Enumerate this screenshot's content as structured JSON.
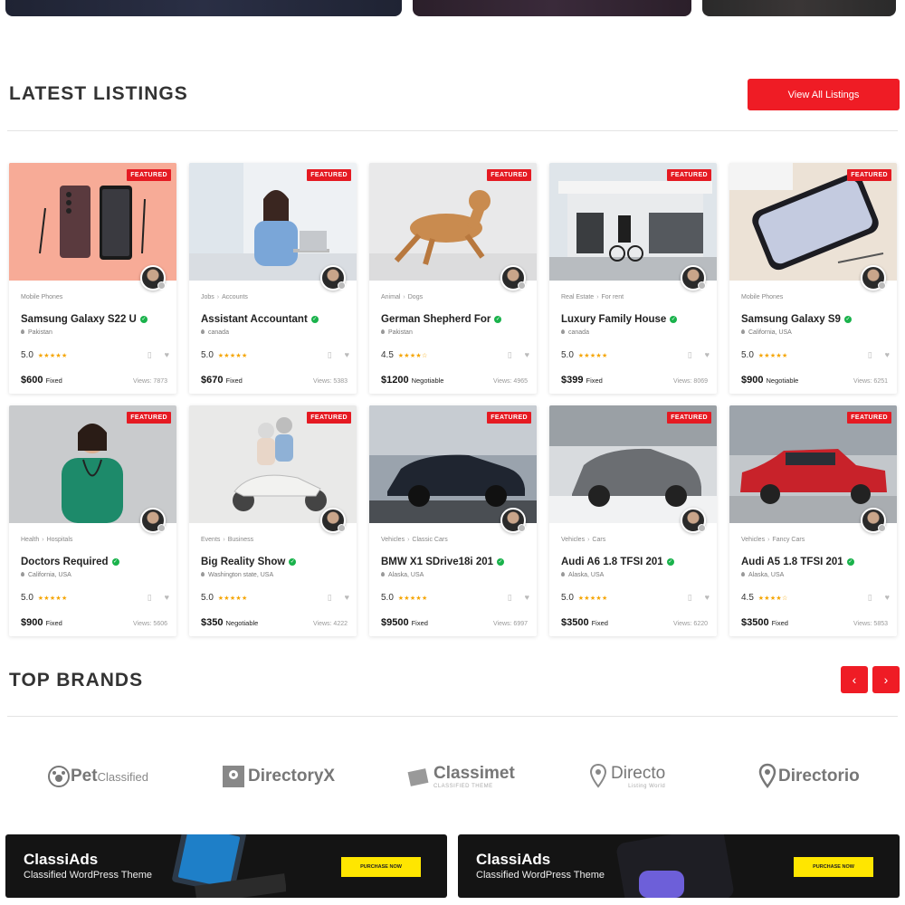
{
  "latest": {
    "title": "LATEST LISTINGS",
    "view_all_label": "View All Listings",
    "featured_label": "FEATURED",
    "listings": [
      {
        "crumb1": "Mobile Phones",
        "crumb2": "",
        "title": "Samsung Galaxy S22 U",
        "location": "Pakistan",
        "rating": "5.0",
        "stars": "★★★★★",
        "price": "$600",
        "price_type": "Fixed",
        "views": "Views: 7873"
      },
      {
        "crumb1": "Jobs",
        "crumb2": "Accounts",
        "title": "Assistant Accountant",
        "location": "canada",
        "rating": "5.0",
        "stars": "★★★★★",
        "price": "$670",
        "price_type": "Fixed",
        "views": "Views: 5383"
      },
      {
        "crumb1": "Animal",
        "crumb2": "Dogs",
        "title": "German Shepherd For",
        "location": "Pakistan",
        "rating": "4.5",
        "stars": "★★★★☆",
        "price": "$1200",
        "price_type": "Negotiable",
        "views": "Views: 4965"
      },
      {
        "crumb1": "Real Estate",
        "crumb2": "For rent",
        "title": "Luxury Family House",
        "location": "canada",
        "rating": "5.0",
        "stars": "★★★★★",
        "price": "$399",
        "price_type": "Fixed",
        "views": "Views: 8069"
      },
      {
        "crumb1": "Mobile Phones",
        "crumb2": "",
        "title": "Samsung Galaxy S9",
        "location": "California, USA",
        "rating": "5.0",
        "stars": "★★★★★",
        "price": "$900",
        "price_type": "Negotiable",
        "views": "Views: 6251"
      },
      {
        "crumb1": "Health",
        "crumb2": "Hospitals",
        "title": "Doctors Required",
        "location": "California, USA",
        "rating": "5.0",
        "stars": "★★★★★",
        "price": "$900",
        "price_type": "Fixed",
        "views": "Views: 5606"
      },
      {
        "crumb1": "Events",
        "crumb2": "Business",
        "title": "Big Reality Show",
        "location": "Washington state, USA",
        "rating": "5.0",
        "stars": "★★★★★",
        "price": "$350",
        "price_type": "Negotiable",
        "views": "Views: 4222"
      },
      {
        "crumb1": "Vehicles",
        "crumb2": "Classic Cars",
        "title": "BMW X1 SDrive18i 201",
        "location": "Alaska, USA",
        "rating": "5.0",
        "stars": "★★★★★",
        "price": "$9500",
        "price_type": "Fixed",
        "views": "Views: 6997"
      },
      {
        "crumb1": "Vehicles",
        "crumb2": "Cars",
        "title": "Audi A6 1.8 TFSI 201",
        "location": "Alaska, USA",
        "rating": "5.0",
        "stars": "★★★★★",
        "price": "$3500",
        "price_type": "Fixed",
        "views": "Views: 6220"
      },
      {
        "crumb1": "Vehicles",
        "crumb2": "Fancy Cars",
        "title": "Audi A5 1.8 TFSI 201",
        "location": "Alaska, USA",
        "rating": "4.5",
        "stars": "★★★★☆",
        "price": "$3500",
        "price_type": "Fixed",
        "views": "Views: 5853"
      }
    ]
  },
  "brands": {
    "title": "TOP BRANDS",
    "prev_icon": "chevron-left-icon",
    "next_icon": "chevron-right-icon",
    "items": [
      {
        "name": "Pet",
        "name2": "Classified",
        "sub": ""
      },
      {
        "name": "DirectoryX",
        "name2": "",
        "sub": ""
      },
      {
        "name": "Classimet",
        "name2": "",
        "sub": "CLASSIFIED THEME"
      },
      {
        "name": "Directo",
        "name2": "",
        "sub": "Listing World"
      },
      {
        "name": "Directorio",
        "name2": "",
        "sub": ""
      }
    ]
  },
  "promos": [
    {
      "title": "ClassiAds",
      "subtitle": "Classified WordPress Theme",
      "button": "PURCHASE NOW"
    },
    {
      "title": "ClassiAds",
      "subtitle": "Classified WordPress Theme",
      "button": "PURCHASE NOW"
    }
  ],
  "colors": {
    "accent": "#ef1c25",
    "verified": "#19b24b",
    "star": "#f5a500",
    "promo_button": "#ffe600"
  }
}
